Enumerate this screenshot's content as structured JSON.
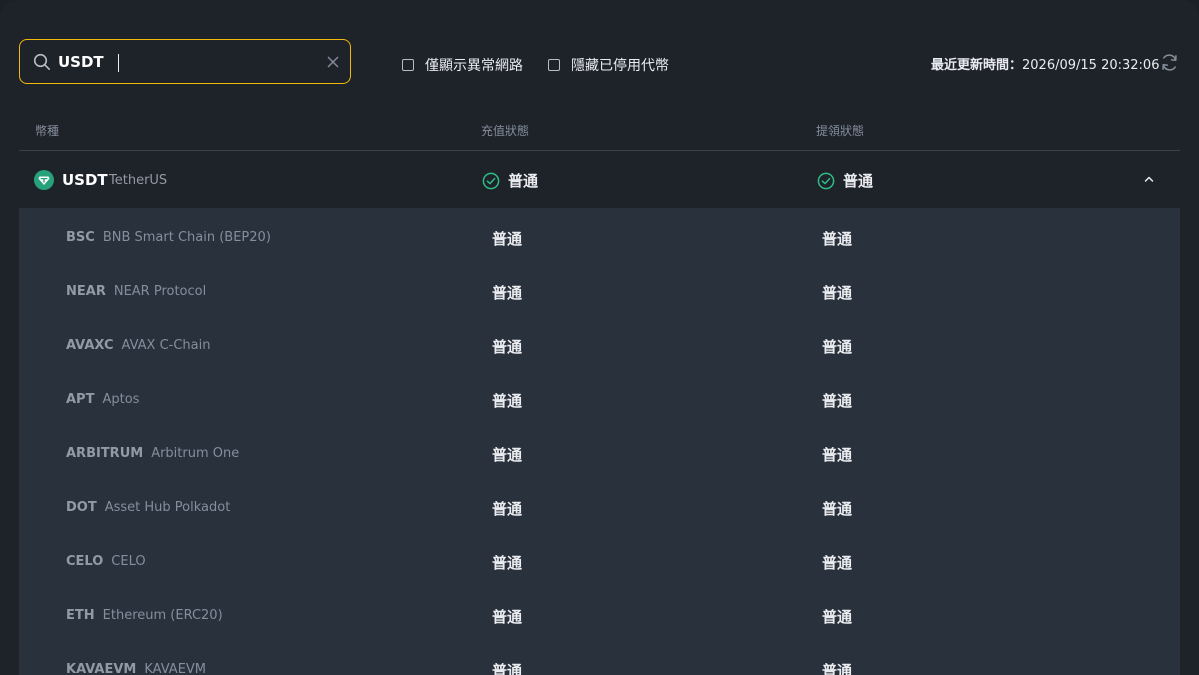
{
  "search": {
    "value": "USDT"
  },
  "filters": [
    {
      "label": "僅顯示異常網路",
      "checked": false
    },
    {
      "label": "隱藏已停用代幣",
      "checked": false
    }
  ],
  "updated": {
    "label": "最近更新時間：",
    "time": "2026/09/15 20:32:06"
  },
  "table": {
    "headers": [
      "幣種",
      "充值狀態",
      "提領狀態"
    ]
  },
  "coin": {
    "symbol": "USDT",
    "name": "TetherUS",
    "deposit_status": "普通",
    "withdraw_status": "普通",
    "expanded": true
  },
  "networks": [
    {
      "code": "BSC",
      "name": "BNB Smart Chain (BEP20)",
      "deposit": "普通",
      "withdraw": "普通"
    },
    {
      "code": "NEAR",
      "name": "NEAR Protocol",
      "deposit": "普通",
      "withdraw": "普通"
    },
    {
      "code": "AVAXC",
      "name": "AVAX C-Chain",
      "deposit": "普通",
      "withdraw": "普通"
    },
    {
      "code": "APT",
      "name": "Aptos",
      "deposit": "普通",
      "withdraw": "普通"
    },
    {
      "code": "ARBITRUM",
      "name": "Arbitrum One",
      "deposit": "普通",
      "withdraw": "普通"
    },
    {
      "code": "DOT",
      "name": "Asset Hub Polkadot",
      "deposit": "普通",
      "withdraw": "普通"
    },
    {
      "code": "CELO",
      "name": "CELO",
      "deposit": "普通",
      "withdraw": "普通"
    },
    {
      "code": "ETH",
      "name": "Ethereum (ERC20)",
      "deposit": "普通",
      "withdraw": "普通"
    },
    {
      "code": "KAVAEVM",
      "name": "KAVAEVM",
      "deposit": "普通",
      "withdraw": "普通"
    }
  ],
  "colors": {
    "accent": "#f0b90b",
    "success": "#2ebd85",
    "tether": "#26a17b"
  }
}
